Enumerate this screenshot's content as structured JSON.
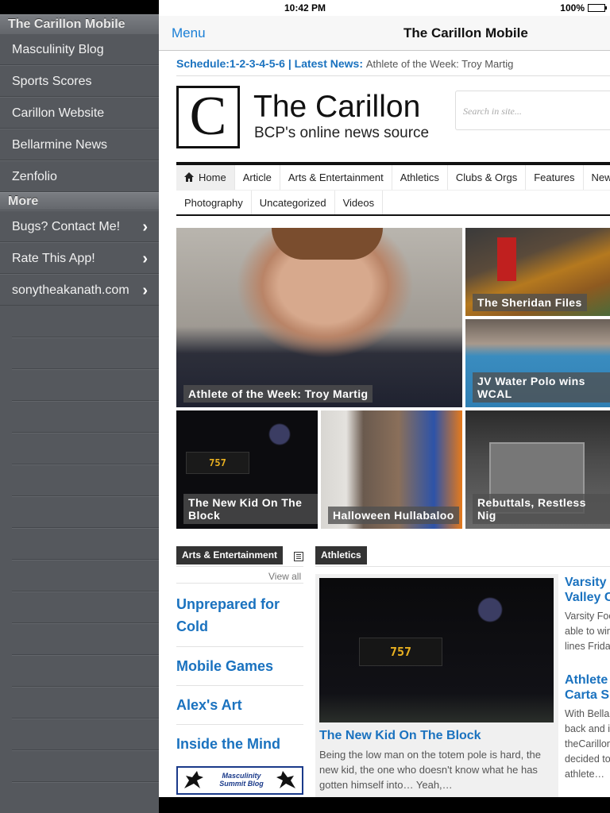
{
  "status": {
    "time": "10:42 PM",
    "battery": "100%"
  },
  "navbar": {
    "menu_label": "Menu",
    "title": "The Carillon Mobile"
  },
  "sidebar": {
    "section1_title": "The Carillon Mobile",
    "items": [
      {
        "label": "Masculinity Blog"
      },
      {
        "label": "Sports Scores"
      },
      {
        "label": "Carillon Website"
      },
      {
        "label": "Bellarmine News"
      },
      {
        "label": "Zenfolio"
      }
    ],
    "section2_title": "More",
    "more_items": [
      {
        "label": "Bugs? Contact Me!"
      },
      {
        "label": "Rate This App!"
      },
      {
        "label": "sonytheakanath.com"
      }
    ]
  },
  "site": {
    "ticker_schedule": "Schedule:1-2-3-4-5-6",
    "ticker_sep": " | ",
    "ticker_latest": "Latest News:",
    "ticker_headline": "Athlete of the Week: Troy Martig",
    "logo_letter": "C",
    "title": "The Carillon",
    "subtitle": "BCP's online news source",
    "search_placeholder": "Search in site...",
    "menu_row1": [
      "Home",
      "Article",
      "Arts & Entertainment",
      "Athletics",
      "Clubs & Orgs",
      "Features",
      "New"
    ],
    "menu_row2": [
      "Photography",
      "Uncategorized",
      "Videos"
    ],
    "featured": {
      "main": "Athlete of the Week: Troy Martig",
      "t1": "The Sheridan Files",
      "t2": "JV Water Polo wins WCAL",
      "t3": "The New Kid On The Block",
      "t4": "Halloween Hullabaloo",
      "t5": "Rebuttals, Restless Nig"
    },
    "arts": {
      "tag": "Arts & Entertainment",
      "view_all": "View all",
      "items": [
        "Unprepared for Cold",
        "Mobile Games",
        "Alex's Art",
        "Inside the Mind"
      ],
      "banner_text": "Masculinity Summit Blog"
    },
    "athletics": {
      "tag": "Athletics",
      "lead_title": "The New Kid On The Block",
      "lead_body": "Being the low man on the totem pole is hard, the new kid, the one who doesn't know what he has gotten himself into… Yeah,…",
      "side1_title_a": "Varsity",
      "side1_title_b": "Valley C",
      "side1_body": [
        "Varsity Foo",
        "able to win",
        "lines Frida"
      ],
      "side2_title_a": "Athlete",
      "side2_title_b": "Carta S",
      "side2_body": [
        "With Bellar",
        "back and i",
        "theCarillon",
        "decided to",
        "athlete…"
      ]
    },
    "scoreboard": {
      "score": "757"
    }
  }
}
